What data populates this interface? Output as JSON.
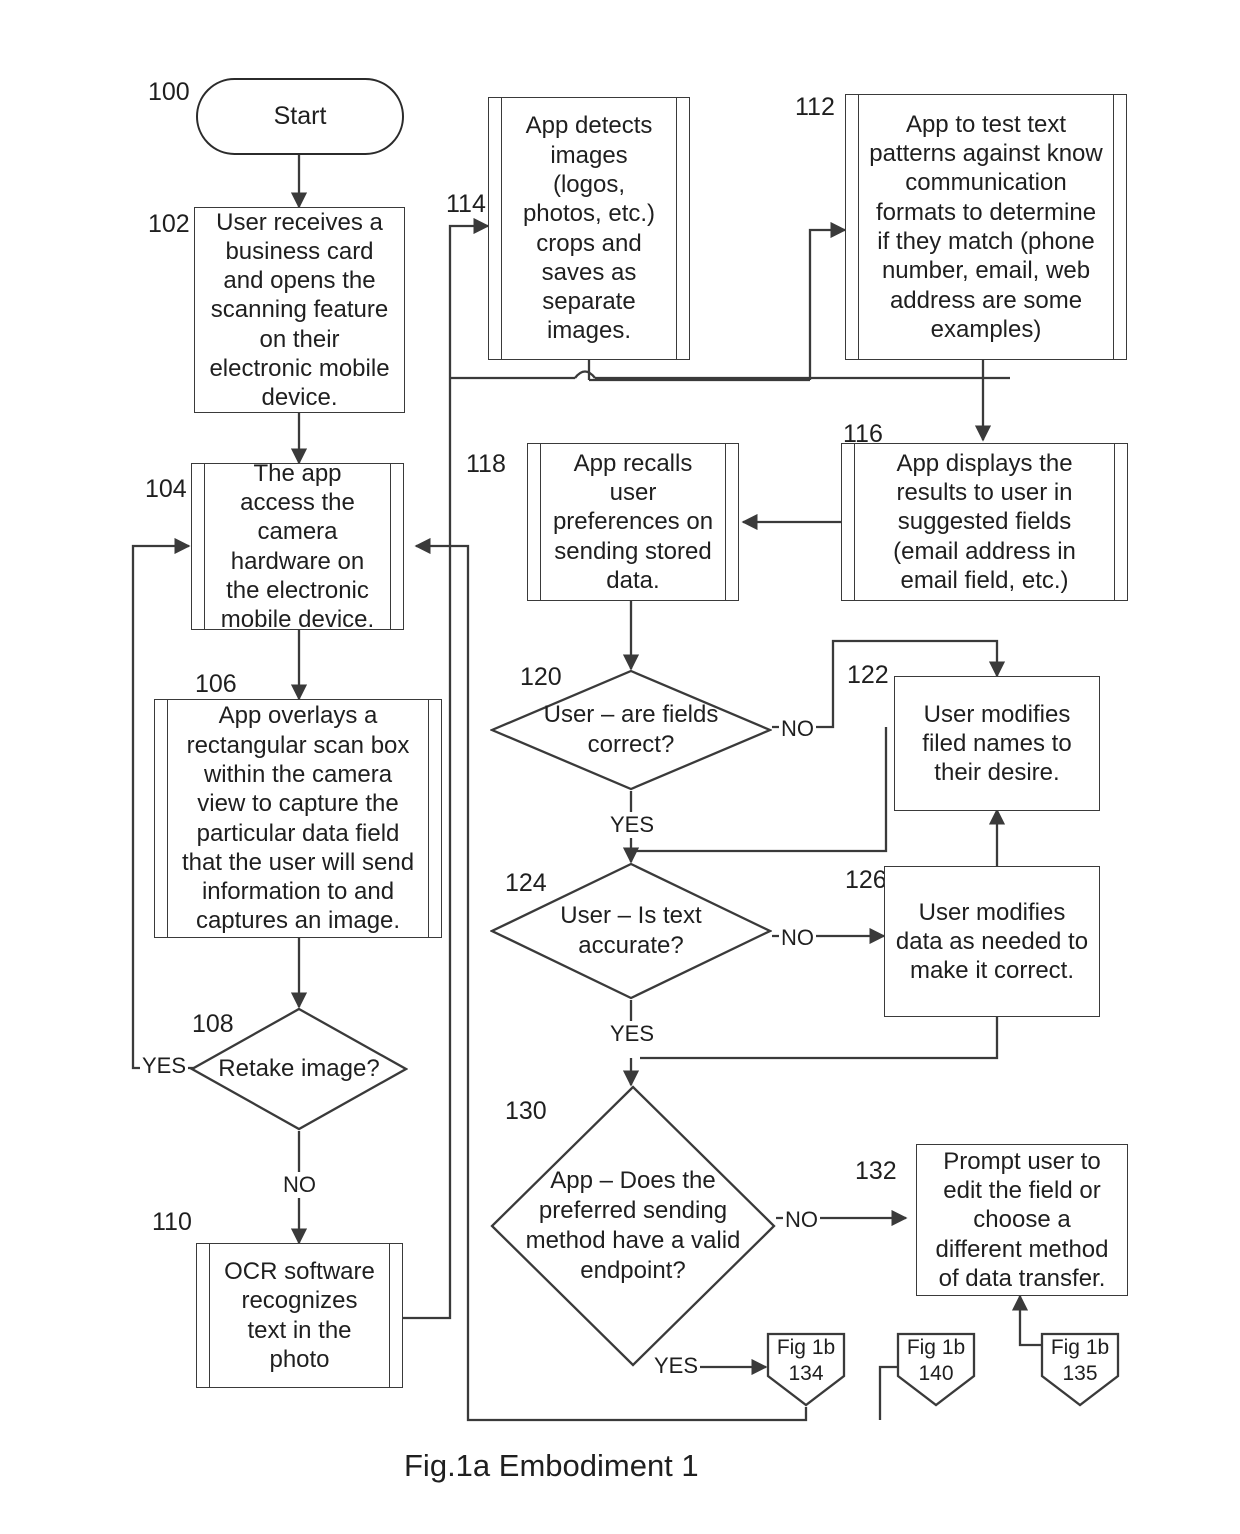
{
  "figure": {
    "caption": "Fig.1a  Embodiment 1",
    "title": "Business card scanning process flowchart"
  },
  "nodes": [
    {
      "id": "100",
      "numeral": "100",
      "shape": "terminator",
      "text": "Start"
    },
    {
      "id": "102",
      "numeral": "102",
      "shape": "process",
      "text": "User receives a business card and opens the scanning feature on their electronic mobile device."
    },
    {
      "id": "104",
      "numeral": "104",
      "shape": "predefined",
      "text": "The app access the camera hardware on the electronic mobile device."
    },
    {
      "id": "106",
      "numeral": "106",
      "shape": "predefined",
      "text": "App overlays a rectangular scan box within the camera view to capture the particular data field that the user will send information to and captures an image."
    },
    {
      "id": "108",
      "numeral": "108",
      "shape": "decision",
      "text": "Retake image?"
    },
    {
      "id": "110",
      "numeral": "110",
      "shape": "predefined",
      "text": "OCR software recognizes text in the photo"
    },
    {
      "id": "114",
      "numeral": "114",
      "shape": "predefined",
      "text": "App detects images (logos, photos, etc.) crops and saves as separate images."
    },
    {
      "id": "112",
      "numeral": "112",
      "shape": "predefined",
      "text": "App to test text patterns against know communication formats to determine if they match (phone number, email, web address are some examples)"
    },
    {
      "id": "116",
      "numeral": "116",
      "shape": "predefined",
      "text": "App displays the results to user in suggested fields (email address in email field, etc.)"
    },
    {
      "id": "118",
      "numeral": "118",
      "shape": "predefined",
      "text": "App recalls user preferences on sending stored data."
    },
    {
      "id": "120",
      "numeral": "120",
      "shape": "decision",
      "text": "User – are fields correct?"
    },
    {
      "id": "122",
      "numeral": "122",
      "shape": "process",
      "text": "User modifies filed names to their desire."
    },
    {
      "id": "124",
      "numeral": "124",
      "shape": "decision",
      "text": "User – Is text accurate?"
    },
    {
      "id": "126",
      "numeral": "126",
      "shape": "process",
      "text": "User modifies data as needed to make it correct."
    },
    {
      "id": "130",
      "numeral": "130",
      "shape": "decision",
      "text": "App – Does the preferred sending method have a valid endpoint?"
    },
    {
      "id": "132",
      "numeral": "132",
      "shape": "process",
      "text": "Prompt user to edit the field or choose a different method of data transfer."
    },
    {
      "id": "134",
      "numeral": "",
      "shape": "offpage",
      "text": "Fig 1b",
      "text2": "134"
    },
    {
      "id": "140",
      "numeral": "",
      "shape": "offpage",
      "text": "Fig 1b",
      "text2": "140"
    },
    {
      "id": "135",
      "numeral": "",
      "shape": "offpage",
      "text": "Fig 1b",
      "text2": "135"
    }
  ],
  "edge_labels": {
    "retake_yes": "YES",
    "retake_no": "NO",
    "fields_no": "NO",
    "fields_yes": "YES",
    "text_no": "NO",
    "text_yes": "YES",
    "endpoint_no": "NO",
    "endpoint_yes": "YES"
  },
  "colors": {
    "stroke": "#3a3a3a",
    "text": "#1f1f1f",
    "background": "#ffffff"
  }
}
